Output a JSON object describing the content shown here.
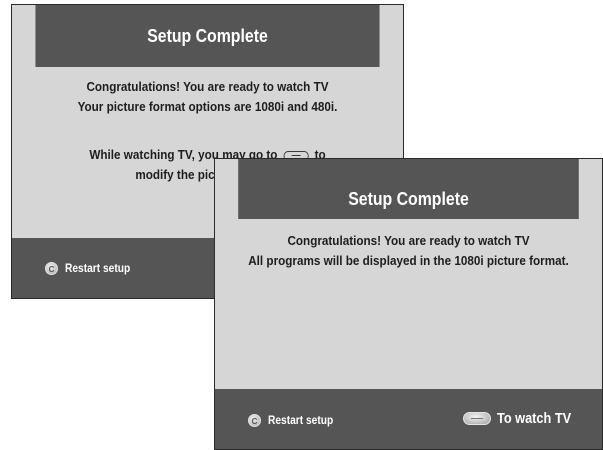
{
  "back_screen": {
    "title": "Setup Complete",
    "message_lines": [
      "Congratulations!  You are ready to watch TV",
      "Your picture format options are 1080i and 480i."
    ],
    "hint_line1_before": "While watching TV, you may go to",
    "hint_line1_after": "to",
    "hint_line2": "modify the picture format.",
    "hint_icon": "format-button-icon",
    "restart_label": "Restart setup",
    "restart_icon": "c-button-icon"
  },
  "front_screen": {
    "title": "Setup Complete",
    "message_lines": [
      "Congratulations!  You are ready to watch TV",
      "All programs will be displayed in the 1080i picture format."
    ],
    "restart_label": "Restart setup",
    "restart_icon": "c-button-icon",
    "watch_label": "To watch TV",
    "watch_icon": "power-button-icon"
  },
  "colors": {
    "title_bar": "#555555",
    "panel_body": "#d6d6d6",
    "text_dark": "#1e1e1e",
    "text_light": "#ffffff"
  }
}
